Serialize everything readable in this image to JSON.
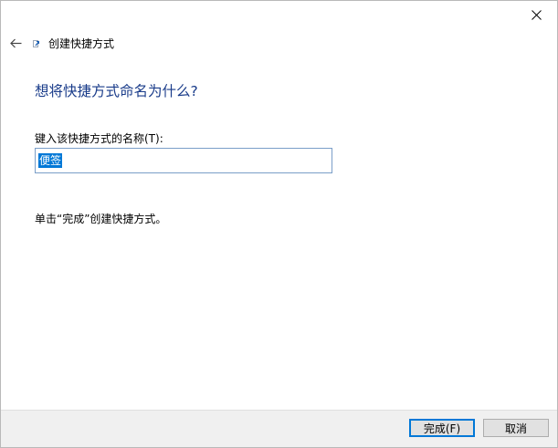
{
  "window": {
    "close_symbol": "×"
  },
  "header": {
    "title": "创建快捷方式",
    "back_icon": "arrow-left-icon",
    "wizard_icon": "shortcut-icon"
  },
  "content": {
    "heading": "想将快捷方式命名为什么?",
    "name_label": "键入该快捷方式的名称(T):",
    "name_value": "便签",
    "hint": "单击“完成”创建快捷方式。"
  },
  "footer": {
    "finish_label": "完成(F)",
    "cancel_label": "取消"
  },
  "colors": {
    "heading": "#1a3c8a",
    "selection": "#0078d7",
    "input_border": "#7a9ec8",
    "footer_bg": "#f0f0f0"
  }
}
